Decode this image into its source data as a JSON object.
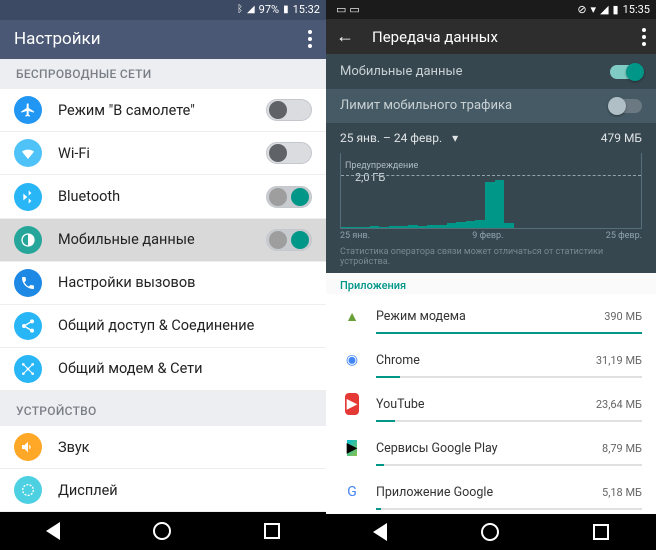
{
  "left": {
    "status": {
      "battery_pct": "97%",
      "time": "15:32"
    },
    "title": "Настройки",
    "section_wireless": "БЕСПРОВОДНЫЕ СЕТИ",
    "section_device": "УСТРОЙСТВО",
    "items": {
      "airplane": "Режим \"В самолете\"",
      "wifi": "Wi-Fi",
      "bluetooth": "Bluetooth",
      "mobile": "Мобильные данные",
      "calls": "Настройки вызовов",
      "share": "Общий доступ & Соединение",
      "modem": "Общий модем & Сети",
      "sound": "Звук",
      "display": "Дисплей"
    }
  },
  "right": {
    "status": {
      "time": "15:35"
    },
    "title": "Передача данных",
    "toggles": {
      "mobile": "Мобильные данные",
      "limit": "Лимит мобильного трафика"
    },
    "range": "25 янв. – 24 февр.",
    "total": "479 МБ",
    "chart": {
      "warn_label": "Предупреждение",
      "warn_value": "2,0 ГБ",
      "x": [
        "25 янв.",
        "9 февр.",
        "25 февр."
      ]
    },
    "disclaimer": "Статистика оператора связи может отличаться от статистики устройства.",
    "apps_header": "Приложения",
    "apps": [
      {
        "name": "Режим модема",
        "value": "390 МБ",
        "pct": 100
      },
      {
        "name": "Chrome",
        "value": "31,19 МБ",
        "pct": 9
      },
      {
        "name": "YouTube",
        "value": "23,64 МБ",
        "pct": 7
      },
      {
        "name": "Сервисы Google Play",
        "value": "8,79 МБ",
        "pct": 3
      },
      {
        "name": "Приложение Google",
        "value": "5,18 МБ",
        "pct": 2
      }
    ]
  },
  "chart_data": {
    "type": "bar",
    "title": "Передача данных",
    "xlabel": "",
    "ylabel": "",
    "x_range": [
      "25 янв.",
      "25 февр."
    ],
    "warning_line_gb": 2.0,
    "total_period_mb": 479,
    "daily_usage_mb_est": [
      2,
      3,
      2,
      4,
      3,
      5,
      4,
      6,
      5,
      7,
      6,
      10,
      12,
      14,
      16,
      95,
      98,
      10,
      0,
      0,
      0,
      0,
      0,
      0,
      0,
      0,
      0,
      0,
      0,
      0,
      0
    ],
    "notes": "Values are visual estimates; chart shows a spike near 9 февр. then drops to zero. Y-axis max corresponds to 2 ГБ warning line."
  }
}
